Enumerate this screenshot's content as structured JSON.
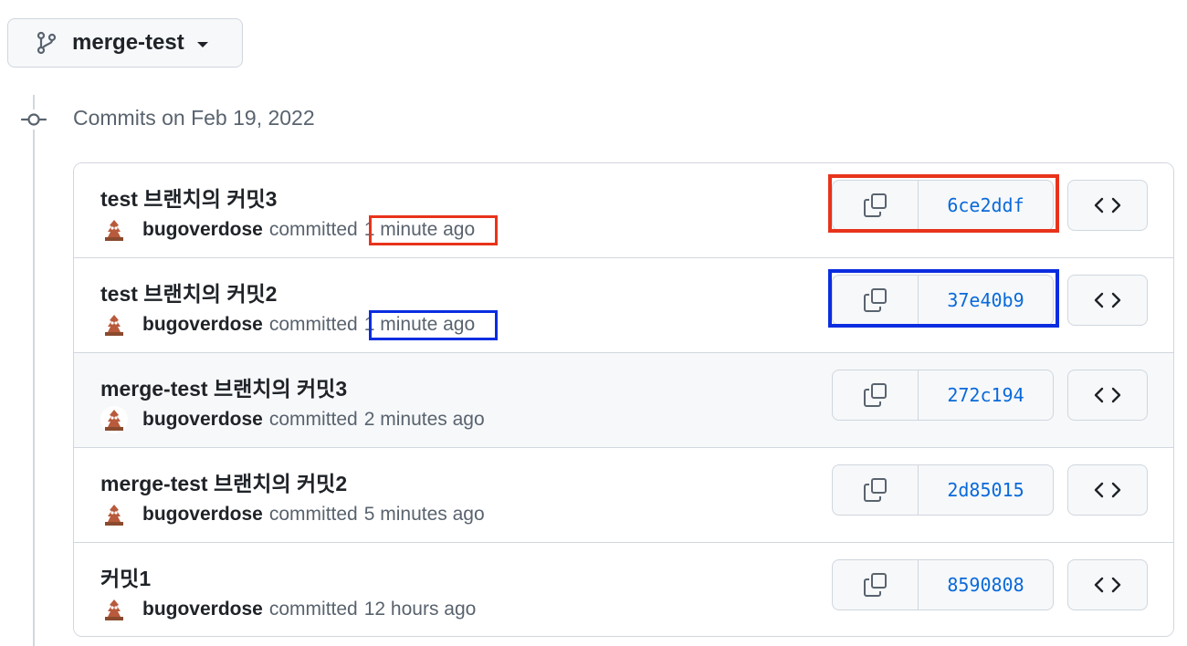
{
  "branch": {
    "name": "merge-test",
    "icon": "git-branch-icon"
  },
  "timeline": {
    "date_heading": "Commits on Feb 19, 2022",
    "icon": "git-commit-icon"
  },
  "commits": [
    {
      "title": "test 브랜치의 커밋3",
      "author": "bugoverdose",
      "verb": "committed",
      "time": "1 minute ago",
      "sha": "6ce2ddf",
      "annotation_color": "#e8331b"
    },
    {
      "title": "test 브랜치의 커밋2",
      "author": "bugoverdose",
      "verb": "committed",
      "time": "1 minute ago",
      "sha": "37e40b9",
      "annotation_color": "#0a2de0"
    },
    {
      "title": "merge-test 브랜치의 커밋3",
      "author": "bugoverdose",
      "verb": "committed",
      "time": "2 minutes ago",
      "sha": "272c194"
    },
    {
      "title": "merge-test 브랜치의 커밋2",
      "author": "bugoverdose",
      "verb": "committed",
      "time": "5 minutes ago",
      "sha": "2d85015"
    },
    {
      "title": "커밋1",
      "author": "bugoverdose",
      "verb": "committed",
      "time": "12 hours ago",
      "sha": "8590808"
    }
  ],
  "colors": {
    "link": "#0969da",
    "border": "#d0d7de",
    "muted_text": "#59636e",
    "annotation_red": "#e8331b",
    "annotation_blue": "#0a2de0"
  }
}
